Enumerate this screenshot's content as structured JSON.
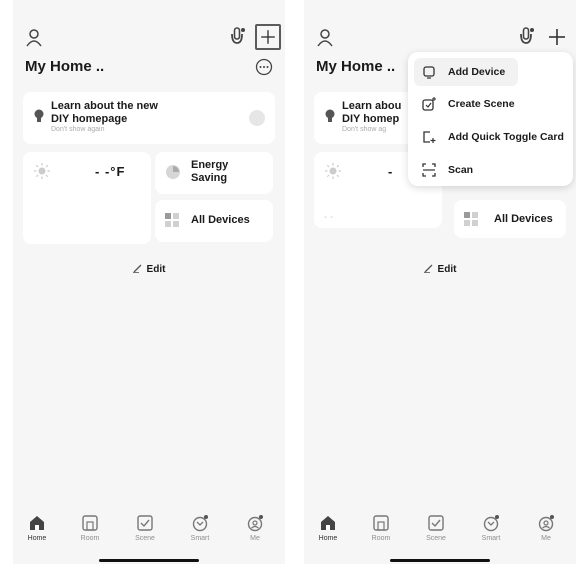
{
  "left": {
    "title": "My Home ..",
    "diy_card": {
      "text_line1": "Learn about the new",
      "text_line2": "DIY homepage",
      "dismiss": "Don't show again"
    },
    "weather": {
      "temp": "- -°F"
    },
    "energy": {
      "line1": "Energy",
      "line2": "Saving"
    },
    "all_devices": "All Devices",
    "edit": "Edit"
  },
  "right": {
    "title": "My Home ..",
    "diy_card": {
      "text_line1": "Learn abou",
      "text_line2": "DIY homep",
      "dismiss": "Don't show ag"
    },
    "weather": {
      "temp": "-",
      "dash": "- -"
    },
    "all_devices": "All Devices",
    "edit": "Edit",
    "menu": [
      {
        "label": "Add Device",
        "icon": "add-device-icon"
      },
      {
        "label": "Create Scene",
        "icon": "create-scene-icon"
      },
      {
        "label": "Add Quick Toggle Card",
        "icon": "quick-toggle-icon"
      },
      {
        "label": "Scan",
        "icon": "scan-icon"
      }
    ]
  },
  "tabs": [
    {
      "label": "Home",
      "icon": "home-icon"
    },
    {
      "label": "Room",
      "icon": "room-icon"
    },
    {
      "label": "Scene",
      "icon": "scene-icon"
    },
    {
      "label": "Smart",
      "icon": "smart-icon"
    },
    {
      "label": "Me",
      "icon": "me-icon"
    }
  ],
  "colors": {
    "background": "#f6f6f6",
    "card": "#ffffff",
    "text": "#1a1a1a",
    "muted": "#8e8e8e"
  }
}
